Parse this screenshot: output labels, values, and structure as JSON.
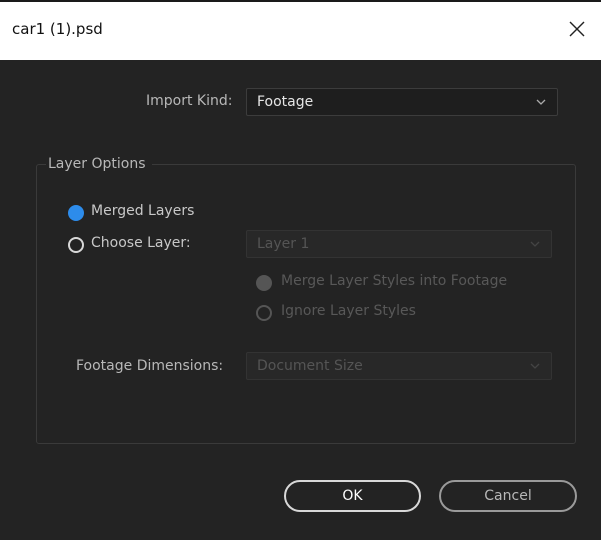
{
  "window": {
    "title": "car1 (1).psd",
    "close_icon": "close-icon"
  },
  "import_kind": {
    "label": "Import Kind:",
    "value": "Footage"
  },
  "layer_options": {
    "legend": "Layer Options",
    "merged_layers": {
      "label": "Merged Layers",
      "selected": true
    },
    "choose_layer": {
      "label": "Choose Layer:",
      "selected": false,
      "value": "Layer 1"
    },
    "merge_styles": {
      "label": "Merge Layer Styles into Footage",
      "selected": true
    },
    "ignore_styles": {
      "label": "Ignore Layer Styles",
      "selected": false
    },
    "footage_dimensions": {
      "label": "Footage Dimensions:",
      "value": "Document Size"
    }
  },
  "buttons": {
    "ok": "OK",
    "cancel": "Cancel"
  },
  "colors": {
    "accent": "#2d8ceb",
    "background": "#232323"
  }
}
